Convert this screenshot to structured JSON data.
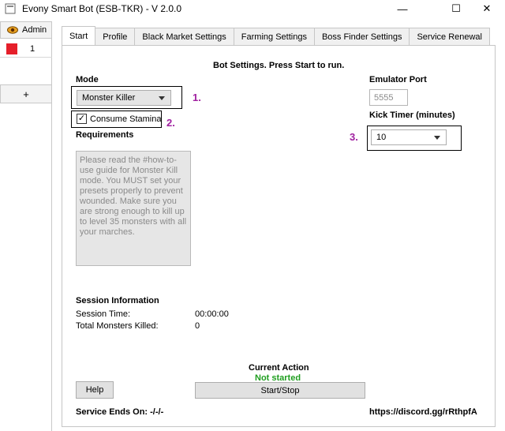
{
  "window": {
    "title": "Evony Smart Bot (ESB-TKR) - V 2.0.0",
    "minimize": "—",
    "maximize": "☐",
    "close": "✕"
  },
  "sidebar": {
    "admin_label": "Admin",
    "account_number": "1",
    "add_label": "+"
  },
  "tabs": [
    {
      "label": "Start",
      "active": true
    },
    {
      "label": "Profile",
      "active": false
    },
    {
      "label": "Black Market Settings",
      "active": false
    },
    {
      "label": "Farming Settings",
      "active": false
    },
    {
      "label": "Boss Finder Settings",
      "active": false
    },
    {
      "label": "Service Renewal",
      "active": false
    }
  ],
  "start": {
    "heading": "Bot Settings. Press Start to run.",
    "mode_label": "Mode",
    "mode_value": "Monster Killer",
    "consume_stamina_label": "Consume Stamina",
    "consume_stamina_checked": true,
    "requirements_label": "Requirements",
    "requirements_text": "Please read the #how-to-use guide for Monster Kill mode. You MUST set your presets properly to prevent wounded. Make sure you are strong enough to kill up to level 35 monsters with all your marches.",
    "emulator_port_label": "Emulator Port",
    "emulator_port_value": "5555",
    "kick_timer_label": "Kick Timer (minutes)",
    "kick_timer_value": "10",
    "session_info_label": "Session Information",
    "session_time_label": "Session Time:",
    "session_time_value": "00:00:00",
    "monsters_killed_label": "Total Monsters Killed:",
    "monsters_killed_value": "0",
    "current_action_label": "Current Action",
    "current_action_value": "Not started",
    "help_label": "Help",
    "start_stop_label": "Start/Stop",
    "service_ends_label": "Service Ends On: -/-/-",
    "discord_link": "https://discord.gg/rRthpfA"
  },
  "annotations": {
    "one": "1.",
    "two": "2.",
    "three": "3."
  },
  "colors": {
    "annotation": "#a020a0",
    "status_green": "#1f9e1f",
    "account_red": "#e51f2a"
  }
}
